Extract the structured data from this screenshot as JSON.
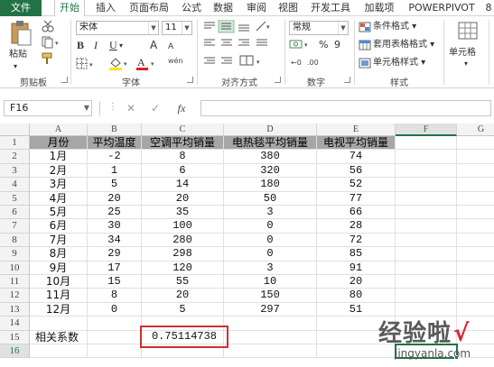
{
  "ribbon_tabs": [
    "文件",
    "开始",
    "插入",
    "页面布局",
    "公式",
    "数据",
    "审阅",
    "视图",
    "开发工具",
    "加载项",
    "POWERPIVOT",
    "8"
  ],
  "clipboard": {
    "paste_label": "粘贴",
    "group_label": "剪贴板"
  },
  "font": {
    "name": "宋体",
    "size": "11",
    "bold": "B",
    "italic": "I",
    "underline": "U",
    "grow": "A",
    "shrink": "A",
    "wen": "wén",
    "group_label": "字体"
  },
  "alignment": {
    "group_label": "对齐方式"
  },
  "number": {
    "format": "常规",
    "percent": "%",
    "comma": "9",
    "currency": "☲",
    "group_label": "数字"
  },
  "styles": {
    "cond_format": "条件格式",
    "table_format": "套用表格格式",
    "cell_style": "单元格样式",
    "group_label": "样式"
  },
  "cells": {
    "label": "单元格"
  },
  "formula_bar": {
    "name_box": "F16",
    "fx": "fx",
    "cancel": "✕",
    "confirm": "✓",
    "formula": ""
  },
  "columns": [
    "A",
    "B",
    "C",
    "D",
    "E",
    "F",
    "G"
  ],
  "rows": [
    "1",
    "2",
    "3",
    "4",
    "5",
    "6",
    "7",
    "8",
    "9",
    "10",
    "11",
    "12",
    "13",
    "14",
    "15",
    "16"
  ],
  "table": {
    "headers": [
      "月份",
      "平均温度",
      "空调平均销量",
      "电热毯平均销量",
      "电视平均销量"
    ],
    "data": [
      [
        "1月",
        "-2",
        "8",
        "380",
        "74"
      ],
      [
        "2月",
        "1",
        "6",
        "320",
        "56"
      ],
      [
        "3月",
        "5",
        "14",
        "180",
        "52"
      ],
      [
        "4月",
        "20",
        "20",
        "50",
        "77"
      ],
      [
        "5月",
        "25",
        "35",
        "3",
        "66"
      ],
      [
        "6月",
        "30",
        "100",
        "0",
        "28"
      ],
      [
        "7月",
        "34",
        "280",
        "0",
        "72"
      ],
      [
        "8月",
        "29",
        "298",
        "0",
        "85"
      ],
      [
        "9月",
        "17",
        "120",
        "3",
        "91"
      ],
      [
        "10月",
        "15",
        "55",
        "10",
        "20"
      ],
      [
        "11月",
        "8",
        "20",
        "150",
        "80"
      ],
      [
        "12月",
        "0",
        "5",
        "297",
        "51"
      ]
    ]
  },
  "correlation": {
    "label": "相关系数",
    "value": "0.75114738"
  },
  "watermark": {
    "main": "经验啦",
    "sub": "jingyanla.com",
    "check": "√"
  },
  "colors": {
    "accent": "#217346",
    "header_fill": "#a6a6a6",
    "highlight": "#d2302e"
  }
}
